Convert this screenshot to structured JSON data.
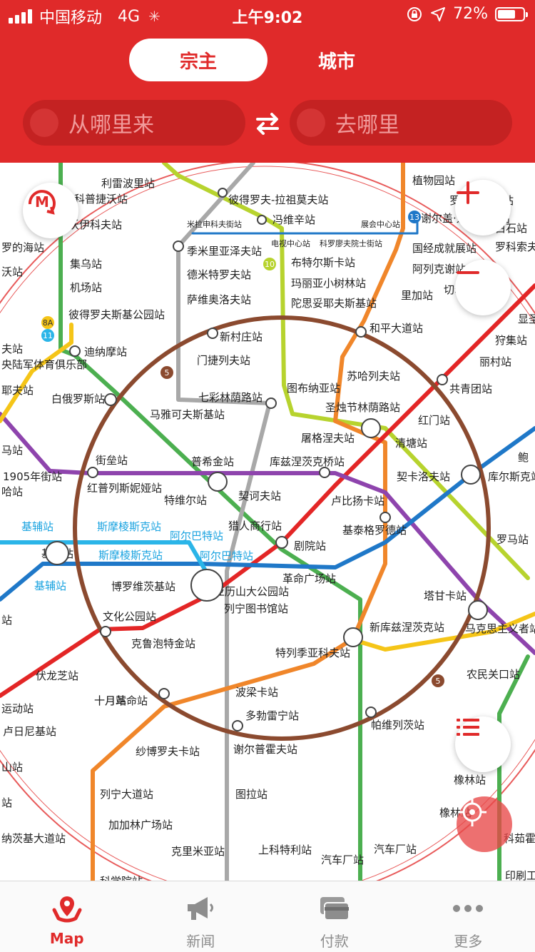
{
  "status_bar": {
    "carrier": "中国移动",
    "network": "4G",
    "time": "上午9:02",
    "battery": "72%",
    "battery_level": 0.72
  },
  "header": {
    "tabs": [
      "宗主",
      "城市"
    ],
    "active_tab": "宗主",
    "from_placeholder": "从哪里来",
    "to_placeholder": "去哪里"
  },
  "colors": {
    "brand": "#e02a2a",
    "line_red": "#e32626",
    "line_green": "#4caf50",
    "line_blue": "#1f78c8",
    "line_lightblue": "#2bb5e8",
    "line_brown": "#8b4a2f",
    "line_orange": "#f0862a",
    "line_purple": "#8e44ad",
    "line_grey": "#a8a8a8",
    "line_lime": "#b7d32e",
    "line_yellow": "#f5c518"
  },
  "map": {
    "line_badges": [
      "5",
      "5",
      "10",
      "11",
      "13",
      "8A"
    ],
    "stations": [
      "利雷波里站",
      "科普捷沃站",
      "沃伊科夫站",
      "罗的海站",
      "沃站",
      "集乌站",
      "机场站",
      "彼得罗夫斯基公园站",
      "迪纳摩站",
      "央陆军体育俱乐部",
      "夫站",
      "耶夫站",
      "白俄罗斯站",
      "马雅可夫斯基站",
      "马站",
      "1905年街站",
      "哈站",
      "街垒站",
      "红普列斯妮娅站",
      "特维尔站",
      "普希金站",
      "契诃夫站",
      "库兹涅茨克桥站",
      "卢比扬卡站",
      "猎人商行站",
      "剧院站",
      "革命广场站",
      "基辅站",
      "基辅站",
      "基辅站",
      "斯摩棱斯克站",
      "斯摩棱斯克站",
      "阿尔巴特站",
      "阿尔巴特站",
      "博罗维茨基站",
      "亚历山大公园站",
      "列宁图书馆站",
      "文化公园站",
      "克鲁泡特金站",
      "站",
      "伏龙芝站",
      "运动站",
      "卢日尼基站",
      "山站",
      "站",
      "纳茨基大道站",
      "十月站",
      "十月革命站",
      "波梁卡站",
      "多勃雷宁站",
      "纱博罗夫卡站",
      "谢尔普霍夫站",
      "列宁大道站",
      "加加林广场站",
      "图拉站",
      "克里米亚站",
      "上科特利站",
      "科学院站",
      "彼得罗夫-拉祖莫夫站",
      "冯维辛站",
      "米拉申科夫街站",
      "电视中心站",
      "科罗廖夫院士街站",
      "展会中心站",
      "季米里亚泽夫站",
      "德米特罗夫站",
      "萨维奥洛夫站",
      "布特尔斯卡站",
      "玛丽亚小树林站",
      "陀思妥耶夫斯基站",
      "新村庄站",
      "门捷列夫站",
      "七彩林荫路站",
      "图布纳亚站",
      "圣烛节林荫路站",
      "屠格涅夫站",
      "植物园站",
      "罗斯托金诺站",
      "谢尔盖·爱森斯坦站",
      "白石站",
      "罗科索夫",
      "国经成就展站",
      "阿列克谢站",
      "里加站",
      "切尔基佐沃站",
      "和平大道站",
      "苏哈列夫站",
      "红门站",
      "清塘站",
      "共青团站",
      "丽村站",
      "狩集站",
      "显圣",
      "契卡洛夫站",
      "库尔斯克站",
      "鲍",
      "基泰格罗德站",
      "罗马站",
      "塔甘卡站",
      "马克思主义者站",
      "新库兹涅茨克站",
      "特列季亚科夫站",
      "农民关口站",
      "帕维列茨站",
      "汽车厂站",
      "汽车厂站",
      "橡林站",
      "橡林站",
      "科茹霍",
      "印刷工"
    ]
  },
  "controls": {
    "metro_logo": "М"
  },
  "tabbar": {
    "items": [
      {
        "label": "Map",
        "icon": "map-pin-icon",
        "active": true
      },
      {
        "label": "新闻",
        "icon": "megaphone-icon",
        "active": false
      },
      {
        "label": "付款",
        "icon": "cards-icon",
        "active": false
      },
      {
        "label": "更多",
        "icon": "more-dots-icon",
        "active": false
      }
    ]
  }
}
